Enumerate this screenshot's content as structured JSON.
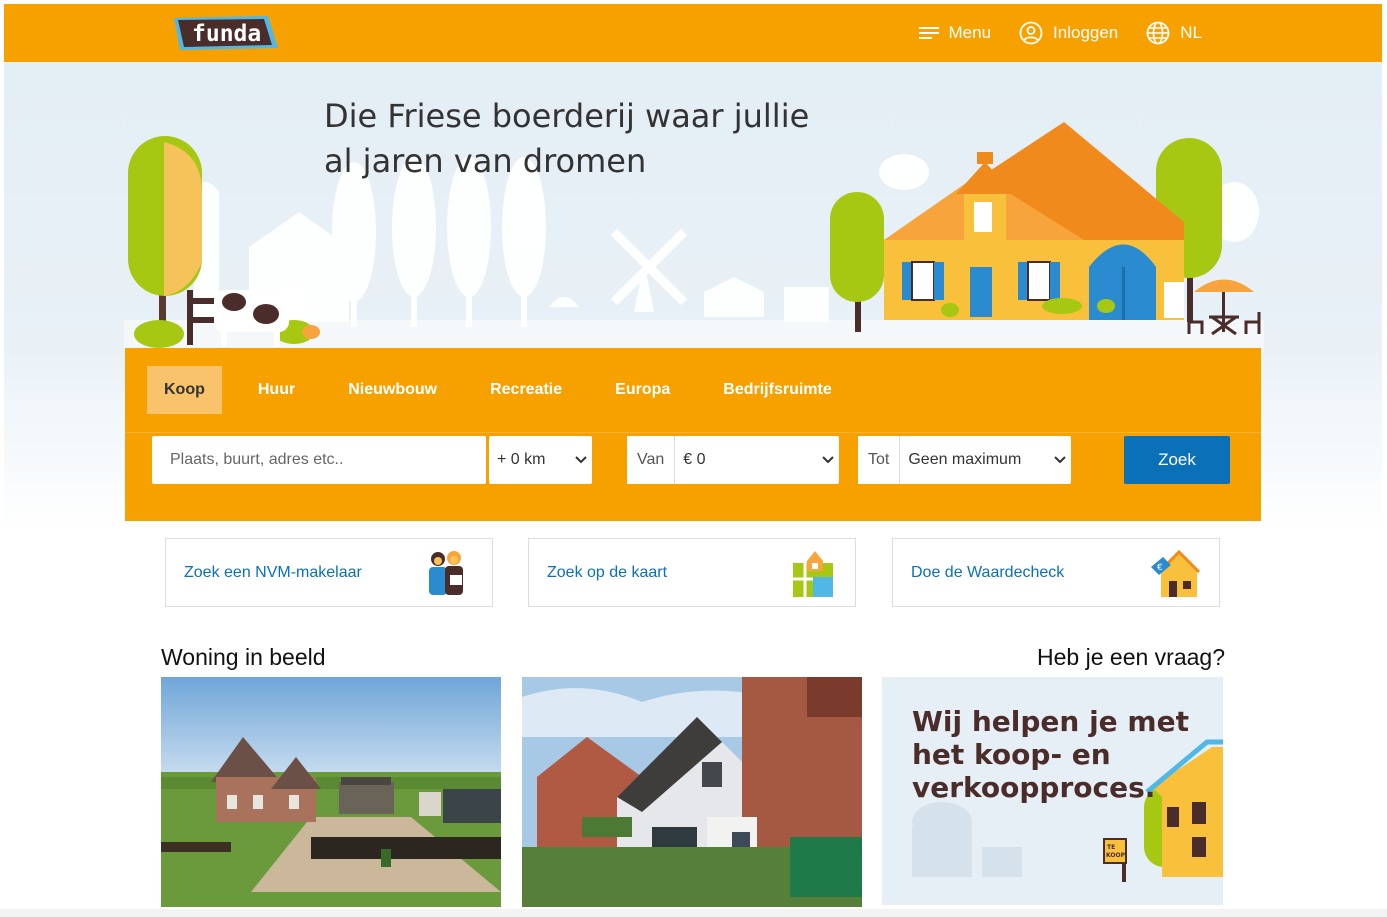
{
  "header": {
    "logo_text": "funda",
    "menu_label": "Menu",
    "login_label": "Inloggen",
    "language_label": "NL"
  },
  "hero": {
    "title_line1": "Die Friese boerderij waar jullie",
    "title_line2": "al jaren van dromen"
  },
  "search": {
    "tabs": [
      "Koop",
      "Huur",
      "Nieuwbouw",
      "Recreatie",
      "Europa",
      "Bedrijfsruimte"
    ],
    "active_tab": "Koop",
    "placeholder": "Plaats, buurt, adres etc..",
    "radius_value": "+ 0 km",
    "price_from_label": "Van",
    "price_from_value": "€ 0",
    "price_to_label": "Tot",
    "price_to_value": "Geen maximum",
    "submit_label": "Zoek"
  },
  "quick_links": [
    {
      "label": "Zoek een NVM-makelaar",
      "icon": "agents-icon"
    },
    {
      "label": "Zoek op de kaart",
      "icon": "map-icon"
    },
    {
      "label": "Doe de Waardecheck",
      "icon": "house-value-icon"
    }
  ],
  "sections": {
    "featured_title": "Woning in beeld",
    "question_title": "Heb je een vraag?",
    "promo_text_line1": "Wij helpen je met",
    "promo_text_line2": "het koop- en",
    "promo_text_line3": "verkoopproces."
  },
  "colors": {
    "brand_orange": "#f7a100",
    "brand_blue": "#0a70b8",
    "active_tab": "#f8c36b"
  }
}
